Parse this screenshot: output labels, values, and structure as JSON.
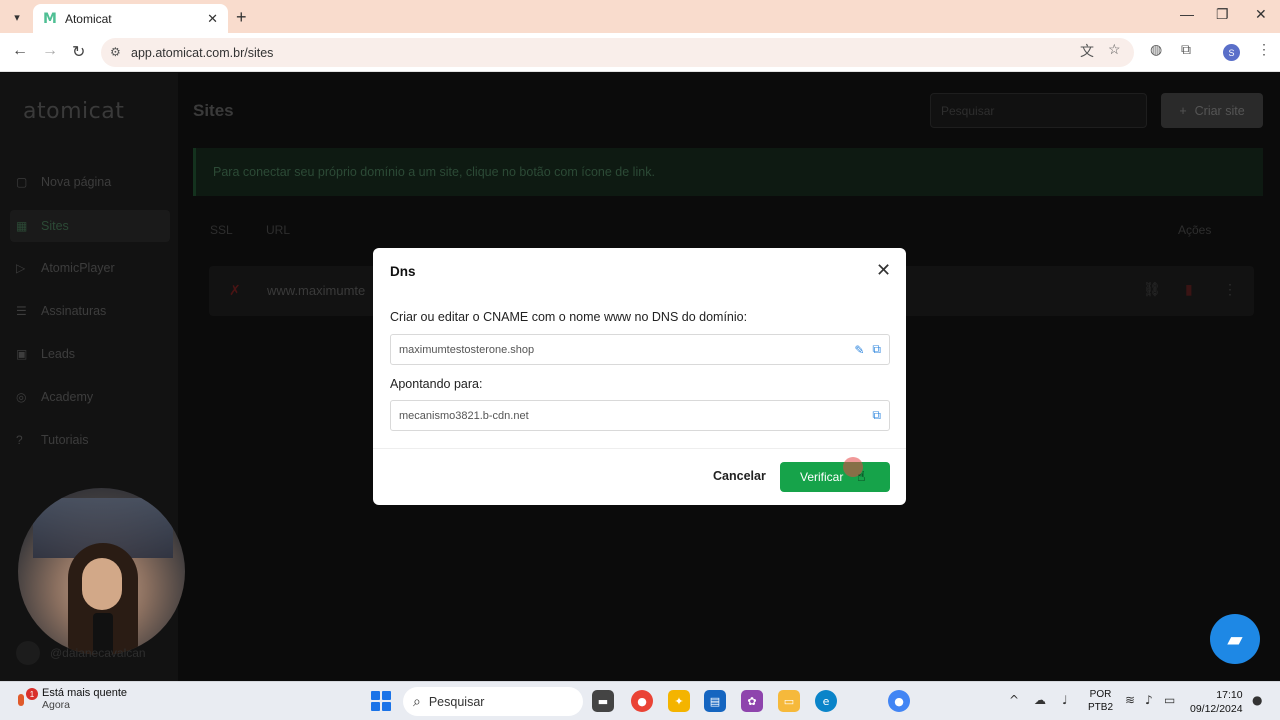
{
  "browser": {
    "tab_title": "Atomicat",
    "url": "app.atomicat.com.br/sites",
    "profile_initial": "S"
  },
  "app": {
    "logo": "atomicat",
    "sidebar": {
      "items": [
        {
          "label": "Nova página",
          "icon": "file-icon"
        },
        {
          "label": "Sites",
          "icon": "layout-icon"
        },
        {
          "label": "AtomicPlayer",
          "icon": "play-icon"
        },
        {
          "label": "Assinaturas",
          "icon": "list-icon"
        },
        {
          "label": "Leads",
          "icon": "users-icon"
        },
        {
          "label": "Academy",
          "icon": "academy-icon"
        },
        {
          "label": "Tutoriais",
          "icon": "help-icon"
        }
      ]
    },
    "page_title": "Sites",
    "search_placeholder": "Pesquisar",
    "create_button": "Criar site",
    "banner_text": "Para conectar seu próprio domínio a um site, clique no botão com ícone de link.",
    "table": {
      "headers": {
        "ssl": "SSL",
        "url": "URL",
        "actions": "Ações"
      },
      "rows": [
        {
          "url": "www.maximumte"
        }
      ]
    },
    "user_handle": "@daianecavalcan"
  },
  "modal": {
    "title": "Dns",
    "instruction": "Criar ou editar o CNAME com o nome www no DNS do domínio:",
    "domain_value": "maximumtestosterone.shop",
    "pointing_label": "Apontando para:",
    "target_value": "mecanismo3821.b-cdn.net",
    "cancel_label": "Cancelar",
    "verify_label": "Verificar"
  },
  "taskbar": {
    "weather_line1": "Está mais quente",
    "weather_line2": "Agora",
    "weather_badge": "1",
    "search_label": "Pesquisar",
    "lang_line1": "POR",
    "lang_line2": "PTB2",
    "time": "17:10",
    "date": "09/12/2024"
  }
}
